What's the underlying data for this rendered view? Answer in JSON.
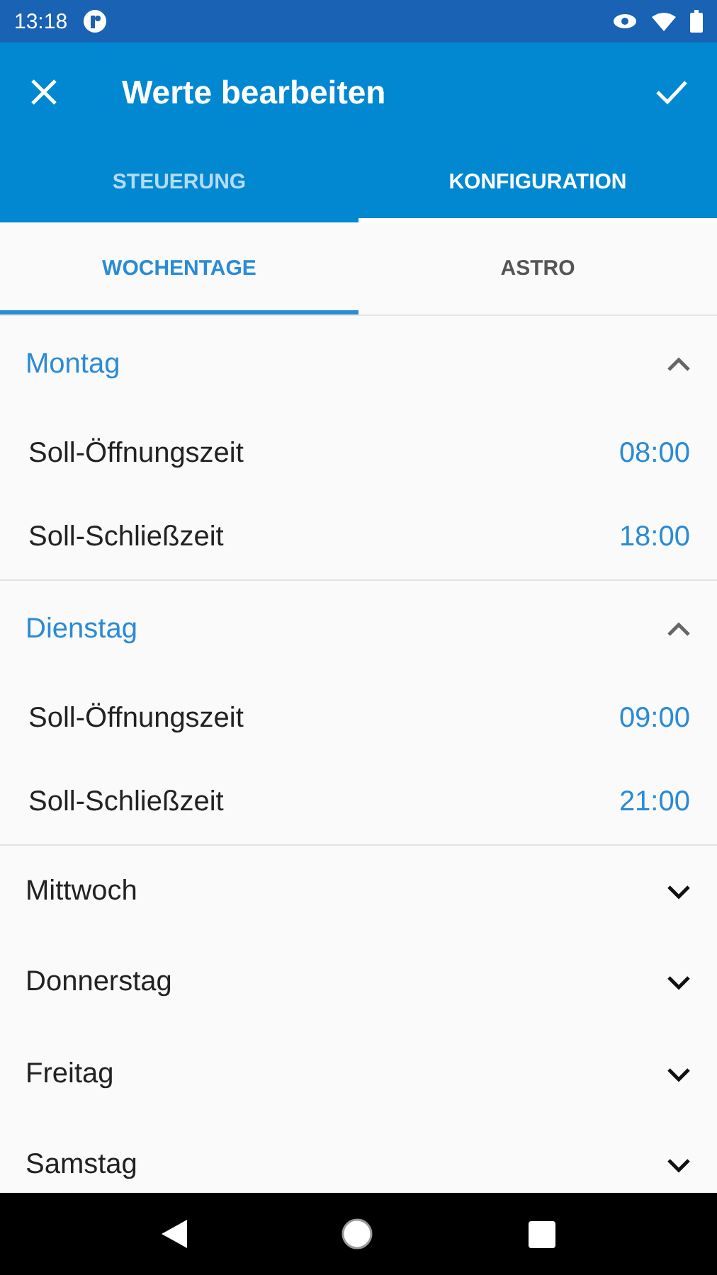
{
  "status_bar": {
    "time": "13:18"
  },
  "app_bar": {
    "title": "Werte bearbeiten"
  },
  "tabs": [
    {
      "label": "STEUERUNG",
      "selected": false
    },
    {
      "label": "KONFIGURATION",
      "selected": true
    }
  ],
  "subtabs": [
    {
      "label": "WOCHENTAGE",
      "selected": true
    },
    {
      "label": "ASTRO",
      "selected": false
    }
  ],
  "days": [
    {
      "name": "Montag",
      "expanded": true,
      "rows": [
        {
          "label": "Soll-Öffnungszeit",
          "value": "08:00"
        },
        {
          "label": "Soll-Schließzeit",
          "value": "18:00"
        }
      ]
    },
    {
      "name": "Dienstag",
      "expanded": true,
      "rows": [
        {
          "label": "Soll-Öffnungszeit",
          "value": "09:00"
        },
        {
          "label": "Soll-Schließzeit",
          "value": "21:00"
        }
      ]
    },
    {
      "name": "Mittwoch",
      "expanded": false
    },
    {
      "name": "Donnerstag",
      "expanded": false
    },
    {
      "name": "Freitag",
      "expanded": false
    },
    {
      "name": "Samstag",
      "expanded": false
    }
  ]
}
